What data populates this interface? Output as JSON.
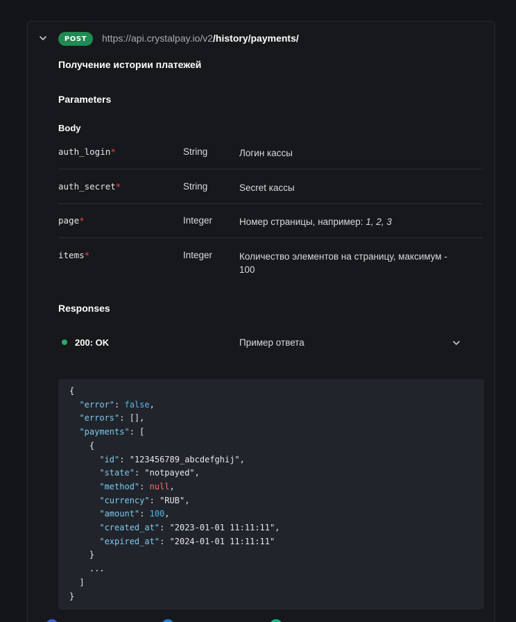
{
  "endpoint": {
    "method": "POST",
    "url_base": "https://api.crystalpay.io/v2",
    "url_path": "/history/payments/",
    "title": "Получение истории платежей"
  },
  "parameters": {
    "heading": "Parameters",
    "body_heading": "Body",
    "items": [
      {
        "name": "auth_login",
        "required": "*",
        "type": "String",
        "description": "Логин кассы"
      },
      {
        "name": "auth_secret",
        "required": "*",
        "type": "String",
        "description": "Secret кассы"
      },
      {
        "name": "page",
        "required": "*",
        "type": "Integer",
        "description_prefix": "Номер страницы, например: ",
        "description_examples": "1, 2, 3"
      },
      {
        "name": "items",
        "required": "*",
        "type": "Integer",
        "description": "Количество элементов на страницу, максимум - 100"
      }
    ]
  },
  "responses": {
    "heading": "Responses",
    "status": "200: OK",
    "example_label": "Пример ответа",
    "status_color": "#2fa86a"
  },
  "code": {
    "lines": [
      [
        {
          "t": "p",
          "v": "{"
        }
      ],
      [
        {
          "t": "p",
          "v": "  "
        },
        {
          "t": "k",
          "v": "\"error\""
        },
        {
          "t": "p",
          "v": ": "
        },
        {
          "t": "v",
          "v": "false"
        },
        {
          "t": "p",
          "v": ","
        }
      ],
      [
        {
          "t": "p",
          "v": "  "
        },
        {
          "t": "k",
          "v": "\"errors\""
        },
        {
          "t": "p",
          "v": ": [],"
        }
      ],
      [
        {
          "t": "p",
          "v": "  "
        },
        {
          "t": "k",
          "v": "\"payments\""
        },
        {
          "t": "p",
          "v": ": ["
        }
      ],
      [
        {
          "t": "p",
          "v": "    {"
        }
      ],
      [
        {
          "t": "p",
          "v": "      "
        },
        {
          "t": "k",
          "v": "\"id\""
        },
        {
          "t": "p",
          "v": ": "
        },
        {
          "t": "s",
          "v": "\"123456789_abcdefghij\""
        },
        {
          "t": "p",
          "v": ","
        }
      ],
      [
        {
          "t": "p",
          "v": "      "
        },
        {
          "t": "k",
          "v": "\"state\""
        },
        {
          "t": "p",
          "v": ": "
        },
        {
          "t": "s",
          "v": "\"notpayed\""
        },
        {
          "t": "p",
          "v": ","
        }
      ],
      [
        {
          "t": "p",
          "v": "      "
        },
        {
          "t": "k",
          "v": "\"method\""
        },
        {
          "t": "p",
          "v": ": "
        },
        {
          "t": "n",
          "v": "null"
        },
        {
          "t": "p",
          "v": ","
        }
      ],
      [
        {
          "t": "p",
          "v": "      "
        },
        {
          "t": "k",
          "v": "\"currency\""
        },
        {
          "t": "p",
          "v": ": "
        },
        {
          "t": "s",
          "v": "\"RUB\""
        },
        {
          "t": "p",
          "v": ","
        }
      ],
      [
        {
          "t": "p",
          "v": "      "
        },
        {
          "t": "k",
          "v": "\"amount\""
        },
        {
          "t": "p",
          "v": ": "
        },
        {
          "t": "v",
          "v": "100"
        },
        {
          "t": "p",
          "v": ","
        }
      ],
      [
        {
          "t": "p",
          "v": "      "
        },
        {
          "t": "k",
          "v": "\"created_at\""
        },
        {
          "t": "p",
          "v": ": "
        },
        {
          "t": "s",
          "v": "\"2023-01-01 11:11:11\""
        },
        {
          "t": "p",
          "v": ","
        }
      ],
      [
        {
          "t": "p",
          "v": "      "
        },
        {
          "t": "k",
          "v": "\"expired_at\""
        },
        {
          "t": "p",
          "v": ": "
        },
        {
          "t": "s",
          "v": "\"2024-01-01 11:11:11\""
        }
      ],
      [
        {
          "t": "p",
          "v": "    }"
        }
      ],
      [
        {
          "t": "p",
          "v": "    ..."
        }
      ],
      [
        {
          "t": "p",
          "v": "  ]"
        }
      ],
      [
        {
          "t": "p",
          "v": "}"
        }
      ]
    ]
  },
  "colors": {
    "method_badge": "#1f8a52",
    "required_marker": "#e5484d",
    "json_key": "#7fc8f0",
    "json_literal": "#5bb3e8",
    "json_null": "#ff6b6b"
  },
  "bottom_icons": [
    {
      "name": "blue-circle-icon",
      "color": "#3b5bdb"
    },
    {
      "name": "blue-circle-icon-2",
      "color": "#1c7ed6"
    },
    {
      "name": "teal-circle-icon",
      "color": "#12b886"
    }
  ]
}
